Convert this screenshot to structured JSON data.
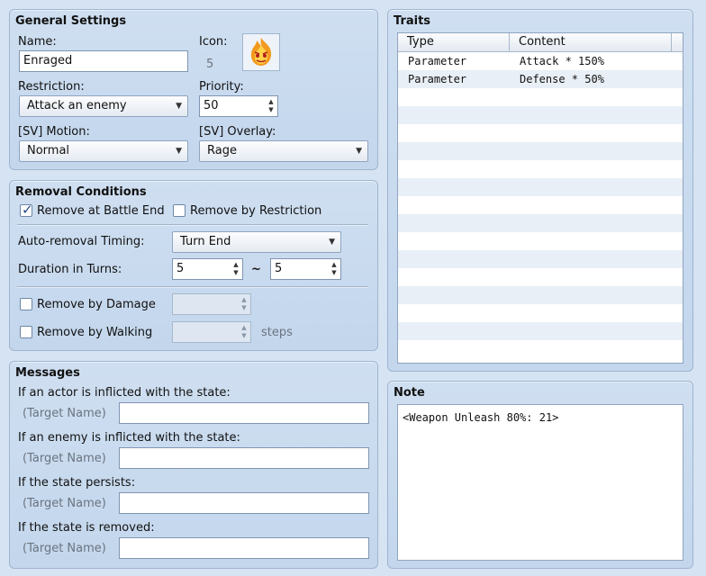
{
  "general": {
    "title": "General Settings",
    "name_label": "Name:",
    "name_value": "Enraged",
    "icon_label": "Icon:",
    "icon_index": "5",
    "restriction_label": "Restriction:",
    "restriction_value": "Attack an enemy",
    "priority_label": "Priority:",
    "priority_value": "50",
    "motion_label": "[SV] Motion:",
    "motion_value": "Normal",
    "overlay_label": "[SV] Overlay:",
    "overlay_value": "Rage"
  },
  "removal": {
    "title": "Removal Conditions",
    "battle_end_label": "Remove at Battle End",
    "battle_end_checked": true,
    "by_restriction_label": "Remove by Restriction",
    "timing_label": "Auto-removal Timing:",
    "timing_value": "Turn End",
    "duration_label": "Duration in Turns:",
    "duration_min": "5",
    "duration_sep": "~",
    "duration_max": "5",
    "by_damage_label": "Remove by Damage",
    "by_walking_label": "Remove by Walking",
    "steps_label": "steps"
  },
  "messages": {
    "title": "Messages",
    "actor_label": "If an actor is inflicted with the state:",
    "enemy_label": "If an enemy is inflicted with the state:",
    "persists_label": "If the state persists:",
    "removed_label": "If the state is removed:",
    "target_name": "(Target Name)"
  },
  "traits": {
    "title": "Traits",
    "columns": [
      "Type",
      "Content"
    ],
    "rows": [
      [
        "Parameter",
        "Attack * 150%"
      ],
      [
        "Parameter",
        "Defense * 50%"
      ]
    ]
  },
  "note": {
    "title": "Note",
    "text": "<Weapon Unleash 80%: 21>"
  },
  "icons": {
    "state_icon": "flame-face-icon"
  }
}
